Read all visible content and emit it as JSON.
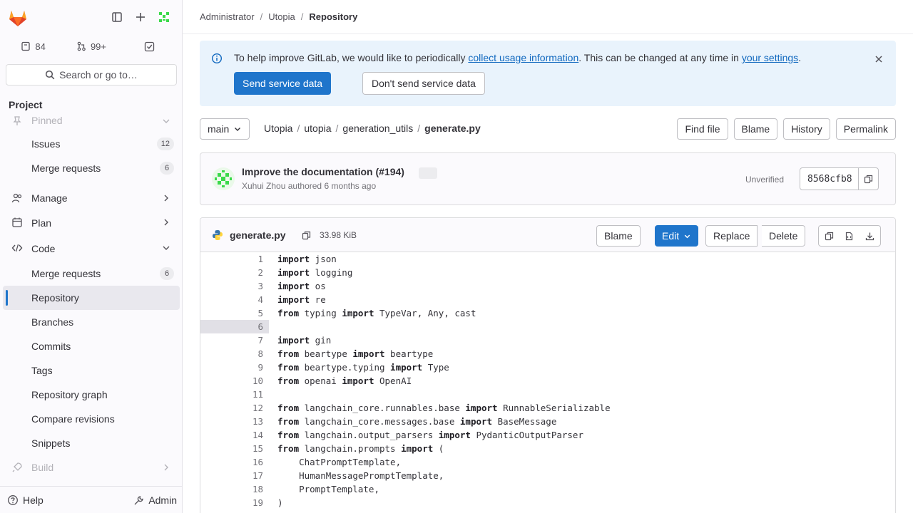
{
  "sidebar": {
    "counts": {
      "issues": "84",
      "merge_requests": "99+"
    },
    "search_label": "Search or go to…",
    "section_title": "Project",
    "items": [
      {
        "label": "Pinned",
        "icon": "pin-icon"
      },
      {
        "label": "Issues",
        "badge": "12"
      },
      {
        "label": "Merge requests",
        "badge": "6"
      },
      {
        "label": "Manage",
        "icon": "users-icon"
      },
      {
        "label": "Plan",
        "icon": "planning-icon"
      },
      {
        "label": "Code",
        "icon": "code-icon"
      },
      {
        "label": "Merge requests",
        "badge": "6"
      },
      {
        "label": "Repository"
      },
      {
        "label": "Branches"
      },
      {
        "label": "Commits"
      },
      {
        "label": "Tags"
      },
      {
        "label": "Repository graph"
      },
      {
        "label": "Compare revisions"
      },
      {
        "label": "Snippets"
      },
      {
        "label": "Build",
        "icon": "rocket-icon"
      }
    ],
    "help_label": "Help",
    "admin_label": "Admin"
  },
  "breadcrumb": [
    "Administrator",
    "Utopia",
    "Repository"
  ],
  "banner": {
    "text_before": "To help improve GitLab, we would like to periodically ",
    "link1": "collect usage information",
    "text_middle": ". This can be changed at any time in ",
    "link2": "your settings",
    "text_after": ".",
    "send_label": "Send service data",
    "dont_send_label": "Don't send service data"
  },
  "repo": {
    "branch": "main",
    "path": [
      "Utopia",
      "utopia",
      "generation_utils"
    ],
    "file": "generate.py",
    "actions": [
      "Find file",
      "Blame",
      "History",
      "Permalink"
    ]
  },
  "commit": {
    "title": "Improve the documentation (#194)",
    "author": "Xuhui Zhou",
    "meta": "authored 6 months ago",
    "status": "Unverified",
    "sha": "8568cfb8"
  },
  "file": {
    "name": "generate.py",
    "size": "33.98 KiB",
    "blame": "Blame",
    "edit": "Edit",
    "replace": "Replace",
    "delete": "Delete"
  },
  "code_lines": [
    {
      "n": "1",
      "kw": "import",
      "rest": " json",
      "pre": ""
    },
    {
      "n": "2",
      "kw": "import",
      "rest": " logging",
      "pre": ""
    },
    {
      "n": "3",
      "kw": "import",
      "rest": " os",
      "pre": ""
    },
    {
      "n": "4",
      "kw": "import",
      "rest": " re",
      "pre": ""
    },
    {
      "n": "5",
      "kw": "from",
      "rest": " typing ",
      "kw2": "import",
      "rest2": " TypeVar, Any, cast",
      "pre": ""
    },
    {
      "n": "6",
      "kw": "",
      "rest": "",
      "pre": ""
    },
    {
      "n": "7",
      "kw": "import",
      "rest": " gin",
      "pre": ""
    },
    {
      "n": "8",
      "kw": "from",
      "rest": " beartype ",
      "kw2": "import",
      "rest2": " beartype",
      "pre": ""
    },
    {
      "n": "9",
      "kw": "from",
      "rest": " beartype.typing ",
      "kw2": "import",
      "rest2": " Type",
      "pre": ""
    },
    {
      "n": "10",
      "kw": "from",
      "rest": " openai ",
      "kw2": "import",
      "rest2": " OpenAI",
      "pre": ""
    },
    {
      "n": "11",
      "kw": "",
      "rest": "",
      "pre": ""
    },
    {
      "n": "12",
      "kw": "from",
      "rest": " langchain_core.runnables.base ",
      "kw2": "import",
      "rest2": " RunnableSerializable",
      "pre": ""
    },
    {
      "n": "13",
      "kw": "from",
      "rest": " langchain_core.messages.base ",
      "kw2": "import",
      "rest2": " BaseMessage",
      "pre": ""
    },
    {
      "n": "14",
      "kw": "from",
      "rest": " langchain.output_parsers ",
      "kw2": "import",
      "rest2": " PydanticOutputParser",
      "pre": ""
    },
    {
      "n": "15",
      "kw": "from",
      "rest": " langchain.prompts ",
      "kw2": "import",
      "rest2": " (",
      "pre": ""
    },
    {
      "n": "16",
      "kw": "",
      "rest": "",
      "pre": "    ChatPromptTemplate,"
    },
    {
      "n": "17",
      "kw": "",
      "rest": "",
      "pre": "    HumanMessagePromptTemplate,"
    },
    {
      "n": "18",
      "kw": "",
      "rest": "",
      "pre": "    PromptTemplate,"
    },
    {
      "n": "19",
      "kw": "",
      "rest": "",
      "pre": ")"
    }
  ],
  "colors": {
    "accent": "#1f75cb",
    "banner_bg": "#e9f3fc",
    "sidebar_bg": "#fbfafd",
    "logo": "#e24329"
  }
}
